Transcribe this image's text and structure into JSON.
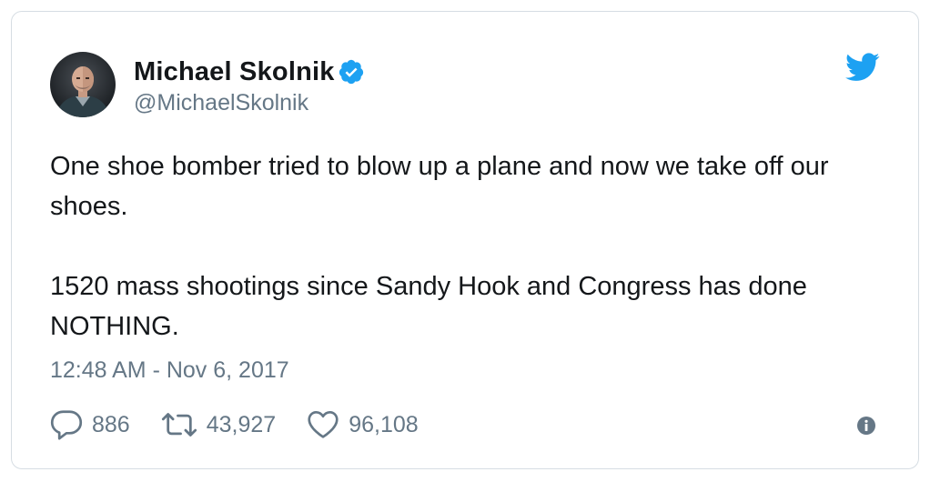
{
  "author": {
    "display_name": "Michael Skolnik",
    "handle": "@MichaelSkolnik",
    "verified": true,
    "avatar_icon": "profile-photo"
  },
  "tweet": {
    "paragraphs": [
      "One shoe bomber tried to blow up a plane and now we take off our shoes.",
      "1520 mass shootings since Sandy Hook and Congress has done NOTHING."
    ],
    "timestamp": "12:48 AM - Nov 6, 2017"
  },
  "actions": {
    "reply": {
      "icon": "reply-icon",
      "count": "886"
    },
    "retweet": {
      "icon": "retweet-icon",
      "count": "43,927"
    },
    "like": {
      "icon": "heart-icon",
      "count": "96,108"
    },
    "info": {
      "icon": "info-icon"
    }
  },
  "colors": {
    "text_primary": "#14171a",
    "text_secondary": "#657786",
    "brand_blue": "#1da1f2",
    "border": "#d6dde3"
  }
}
